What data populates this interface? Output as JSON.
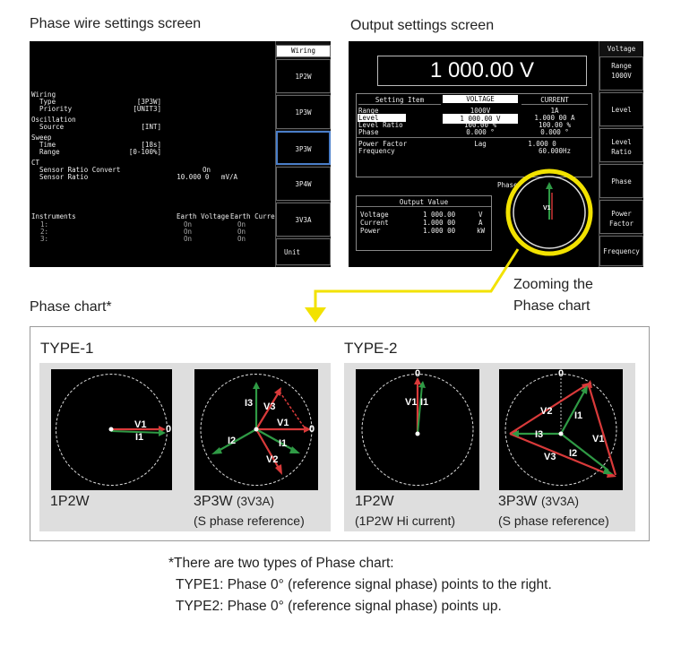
{
  "captions": {
    "phase_wire": "Phase wire settings screen",
    "output": "Output settings screen",
    "phase_chart": "Phase chart*",
    "zoom_line1": "Zooming the",
    "zoom_line2": "Phase chart"
  },
  "phase_wire_screen": {
    "side_header": "Wiring",
    "side_buttons": [
      "1P2W",
      "1P3W",
      "3P3W",
      "3P4W",
      "3V3A",
      "Unit"
    ],
    "lines": [
      {
        "label": "Wiring",
        "value": ""
      },
      {
        "label": "  Type",
        "value": "[3P3W]"
      },
      {
        "label": "  Priority",
        "value": "[UNIT3]"
      },
      {
        "label": "Oscillation",
        "value": ""
      },
      {
        "label": "  Source",
        "value": "[INT]"
      },
      {
        "label": "Sweep",
        "value": ""
      },
      {
        "label": "  Time",
        "value": "[18s]"
      },
      {
        "label": "  Range",
        "value": "[0-100%]"
      },
      {
        "label": "CT",
        "value": ""
      },
      {
        "label": "  Sensor Ratio Convert",
        "value": "On"
      },
      {
        "label": "  Sensor Ratio",
        "value": "10.000 0   mV/A"
      }
    ],
    "instruments": {
      "title": "Instruments",
      "col1": "Earth Voltage",
      "col2": "Earth Current",
      "rows": [
        {
          "n": "1:",
          "v": "On",
          "c": "On"
        },
        {
          "n": "2:",
          "v": "On",
          "c": "On"
        },
        {
          "n": "3:",
          "v": "On",
          "c": "On"
        }
      ]
    }
  },
  "output_screen": {
    "main_value": "1 000.00 V",
    "side_buttons": [
      "Voltage",
      "Range\n1000V",
      "Level",
      "Level\nRatio",
      "Phase",
      "Power\nFactor",
      "Frequency"
    ],
    "table": {
      "headers": [
        "Setting Item",
        "VOLTAGE",
        "CURRENT"
      ],
      "rows": [
        {
          "item": "Range",
          "voltage": "1000V",
          "current": "1A"
        },
        {
          "item": "Level",
          "voltage": "1 000.00 V",
          "current": "1.000 00 A"
        },
        {
          "item": "Level Ratio",
          "voltage": "100.00 %",
          "current": "100.00 %"
        },
        {
          "item": "Phase",
          "voltage": "0.000 °",
          "current": "0.000 °"
        },
        {
          "item": "Power Factor",
          "voltage": "Lag",
          "current": "1.000 0"
        },
        {
          "item": "Frequency",
          "voltage": "",
          "current": "60.000Hz"
        }
      ]
    },
    "output_value": {
      "title": "Output Value",
      "rows": [
        {
          "label": "Voltage",
          "value": "1 000.00",
          "unit": "V"
        },
        {
          "label": "Current",
          "value": "1.000 00",
          "unit": "A"
        },
        {
          "label": "Power",
          "value": "1.000 00",
          "unit": "kW"
        }
      ]
    },
    "phase_label": "Phase",
    "phase_vector_label": "V1"
  },
  "phase_chart": {
    "type1_title": "TYPE-1",
    "type2_title": "TYPE-2",
    "charts": [
      {
        "label": "1P2W",
        "sub": "",
        "labels": {
          "v1": "V1",
          "i1": "I1",
          "zero": "0"
        }
      },
      {
        "label": "3P3W",
        "label_small": "(3V3A)",
        "sub": "(S phase reference)",
        "labels": {
          "i3": "I3",
          "v3": "V3",
          "v1": "V1",
          "zero": "0",
          "i2": "I2",
          "i1": "I1",
          "v2": "V2"
        }
      },
      {
        "label": "1P2W",
        "sub": "(1P2W Hi current)",
        "labels": {
          "zero": "0",
          "v1": "V1",
          "i1": "I1"
        }
      },
      {
        "label": "3P3W",
        "label_small": "(3V3A)",
        "sub": "(S phase reference)",
        "labels": {
          "zero": "0",
          "v2": "V2",
          "i1": "I1",
          "i3": "I3",
          "v1": "V1",
          "v3": "V3",
          "i2": "I2"
        }
      }
    ]
  },
  "footnote": {
    "line1": "*There are two types of Phase chart:",
    "line2": "TYPE1: Phase 0° (reference signal phase) points to the right.",
    "line3": "TYPE2: Phase 0° (reference signal phase) points up."
  },
  "colors": {
    "voltage_vector": "#d93a3a",
    "current_vector": "#2f9a45",
    "highlight": "#f2e200",
    "screen_bg": "#000000"
  }
}
